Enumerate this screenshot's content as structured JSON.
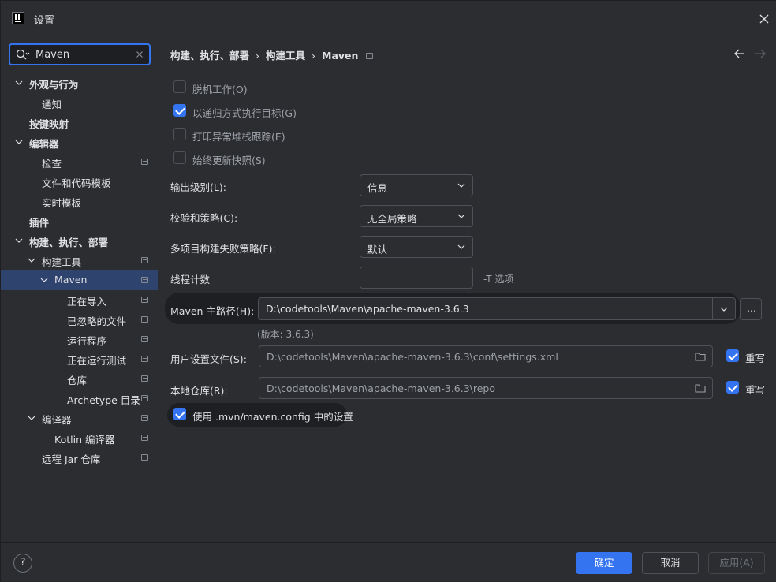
{
  "window": {
    "title": "设置"
  },
  "search": {
    "value": "Maven"
  },
  "tree": [
    {
      "label": "外观与行为",
      "bold": true,
      "chevron": "down",
      "tag": false
    },
    {
      "label": "通知",
      "bold": false,
      "chevron": null,
      "tag": false
    },
    {
      "label": "按键映射",
      "bold": true,
      "chevron": null,
      "tag": false
    },
    {
      "label": "编辑器",
      "bold": true,
      "chevron": "down",
      "tag": false
    },
    {
      "label": "检查",
      "bold": false,
      "chevron": null,
      "tag": true
    },
    {
      "label": "文件和代码模板",
      "bold": false,
      "chevron": null,
      "tag": false
    },
    {
      "label": "实时模板",
      "bold": false,
      "chevron": null,
      "tag": false
    },
    {
      "label": "插件",
      "bold": true,
      "chevron": null,
      "tag": false
    },
    {
      "label": "构建、执行、部署",
      "bold": true,
      "chevron": "down",
      "tag": false
    },
    {
      "label": "构建工具",
      "bold": false,
      "chevron": "down",
      "tag": true
    },
    {
      "label": "Maven",
      "bold": false,
      "chevron": "down",
      "tag": true,
      "selected": true
    },
    {
      "label": "正在导入",
      "bold": false,
      "chevron": null,
      "tag": true
    },
    {
      "label": "已忽略的文件",
      "bold": false,
      "chevron": null,
      "tag": true
    },
    {
      "label": "运行程序",
      "bold": false,
      "chevron": null,
      "tag": true
    },
    {
      "label": "正在运行测试",
      "bold": false,
      "chevron": null,
      "tag": true
    },
    {
      "label": "仓库",
      "bold": false,
      "chevron": null,
      "tag": true
    },
    {
      "label": "Archetype 目录",
      "bold": false,
      "chevron": null,
      "tag": true
    },
    {
      "label": "编译器",
      "bold": false,
      "chevron": "down",
      "tag": true
    },
    {
      "label": "Kotlin 编译器",
      "bold": false,
      "chevron": null,
      "tag": true
    },
    {
      "label": "远程 Jar 仓库",
      "bold": false,
      "chevron": null,
      "tag": true
    }
  ],
  "breadcrumb": {
    "part1": "构建、执行、部署",
    "part2": "构建工具",
    "part3": "Maven",
    "sep": "›"
  },
  "checkboxes": {
    "offline": {
      "label": "脱机工作(O)",
      "checked": false
    },
    "recursive": {
      "label": "以递归方式执行目标(G)",
      "checked": true
    },
    "stacktrace": {
      "label": "打印异常堆栈跟踪(E)",
      "checked": false
    },
    "snapshots": {
      "label": "始终更新快照(S)",
      "checked": false
    }
  },
  "fields": {
    "output_level": {
      "label": "输出级别(L):",
      "value": "信息"
    },
    "checksum": {
      "label": "校验和策略(C):",
      "value": "无全局策略"
    },
    "multiproject": {
      "label": "多项目构建失败策略(F):",
      "value": "默认"
    },
    "threads": {
      "label": "线程计数",
      "value": "",
      "hint": "-T 选项"
    },
    "maven_home": {
      "label": "Maven 主路径(H):",
      "value": "D:\\codetools\\Maven\\apache-maven-3.6.3",
      "browse": "...",
      "version": "(版本: 3.6.3)"
    },
    "user_settings": {
      "label": "用户设置文件(S):",
      "value": "D:\\codetools\\Maven\\apache-maven-3.6.3\\conf\\settings.xml",
      "override_label": "重写",
      "override": true
    },
    "local_repo": {
      "label": "本地仓库(R):",
      "value": "D:\\codetools\\Maven\\apache-maven-3.6.3\\repo",
      "override_label": "重写",
      "override": true
    },
    "mvn_config": {
      "label": "使用 .mvn/maven.config 中的设置",
      "checked": true
    }
  },
  "footer": {
    "help": "?",
    "ok": "确定",
    "cancel": "取消",
    "apply": "应用(A)"
  },
  "colors": {
    "accent": "#3574f0",
    "background": "#2b2d30",
    "selection": "#2e436e"
  }
}
